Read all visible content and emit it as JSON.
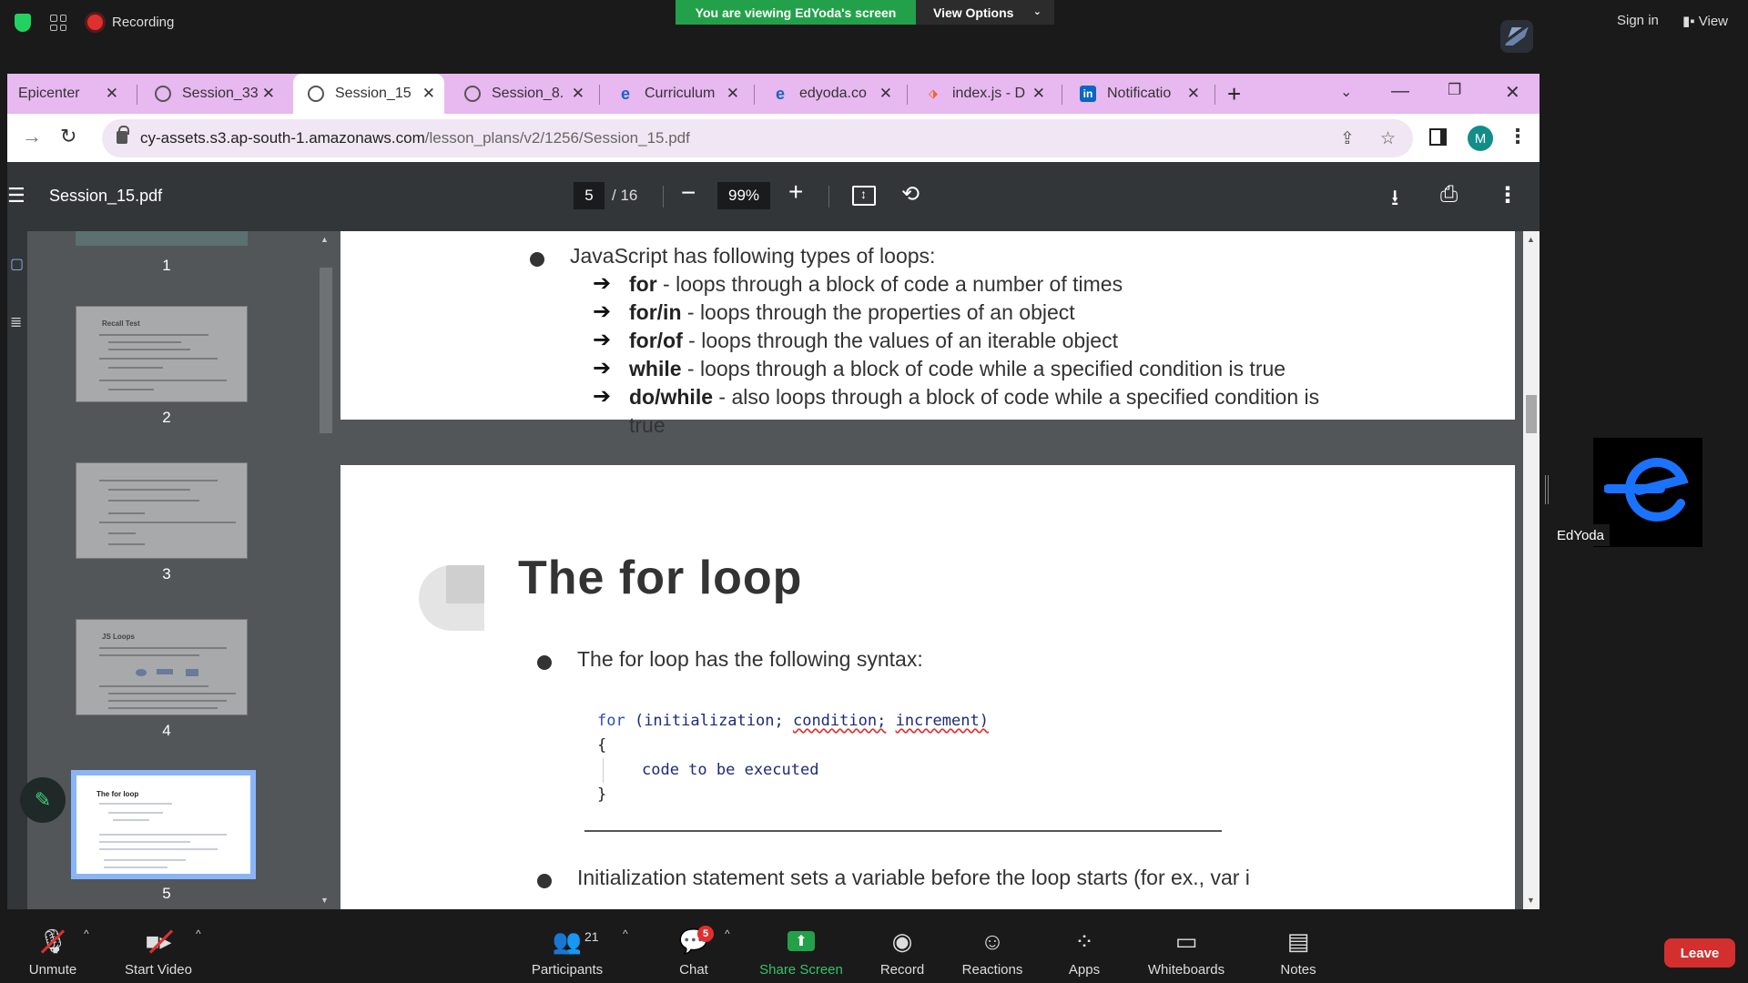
{
  "zoom_top": {
    "recording_label": "Recording",
    "viewing_banner": "You are viewing EdYoda's screen",
    "view_options_label": "View Options",
    "sign_in_label": "Sign in",
    "view_label": "View"
  },
  "browser": {
    "tabs": [
      {
        "title": "Epicenter",
        "icon": "no-icon"
      },
      {
        "title": "Session_33",
        "icon": "globe-icon"
      },
      {
        "title": "Session_15",
        "icon": "globe-icon",
        "active": true
      },
      {
        "title": "Session_8.",
        "icon": "globe-icon"
      },
      {
        "title": "Curriculum",
        "icon": "edyoda-icon"
      },
      {
        "title": "edyoda.co",
        "icon": "edyoda-icon"
      },
      {
        "title": "index.js - D",
        "icon": "index-icon"
      },
      {
        "title": "Notificatio",
        "icon": "linkedin-icon"
      }
    ],
    "url_host": "cy-assets.s3.ap-south-1.amazonaws.com",
    "url_path": "/lesson_plans/v2/1256/Session_15.pdf",
    "profile_initial": "M",
    "profile_color": "#138d8a",
    "tabstrip_color": "#e8b8f0"
  },
  "pdf": {
    "filename": "Session_15.pdf",
    "current_page": "5",
    "total_pages": "/ 16",
    "zoom": "99%",
    "thumbnails": [
      {
        "number": "1",
        "title": ""
      },
      {
        "number": "2",
        "title": "Recall Test"
      },
      {
        "number": "3",
        "title": ""
      },
      {
        "number": "4",
        "title": "JS Loops"
      },
      {
        "number": "5",
        "title": "The for loop"
      }
    ],
    "page4": {
      "intro": "JavaScript has following types of loops:",
      "items": [
        {
          "keyword": "for",
          "text": " - loops through a block of code a number of times"
        },
        {
          "keyword": "for/in",
          "text": " - loops through the properties of an object"
        },
        {
          "keyword": "for/of",
          "text": " - loops through the values of an iterable object"
        },
        {
          "keyword": "while",
          "text": " - loops through a block of code while a specified condition is true"
        },
        {
          "keyword": "do/while",
          "text": " - also loops through a block of code while a specified condition is"
        }
      ],
      "continuation": "true"
    },
    "page5": {
      "title": "The for loop",
      "bullet1": "The for loop has the following syntax:",
      "code": {
        "keyword": "for",
        "open": " (initialization;",
        "part2": "condition;",
        "part3": "increment)",
        "brace_open": "{",
        "body": "code to be executed",
        "brace_close": "}"
      },
      "bullet2": "Initialization statement sets a variable before the loop starts (for ex., var i"
    }
  },
  "participant": {
    "name": "EdYoda",
    "logo_color": "#1a73ff"
  },
  "zoom_bottom": {
    "unmute": "Unmute",
    "start_video": "Start Video",
    "participants": "Participants",
    "participant_count": "21",
    "chat": "Chat",
    "chat_badge": "5",
    "share_screen": "Share Screen",
    "record": "Record",
    "reactions": "Reactions",
    "apps": "Apps",
    "whiteboards": "Whiteboards",
    "notes": "Notes",
    "leave": "Leave"
  }
}
